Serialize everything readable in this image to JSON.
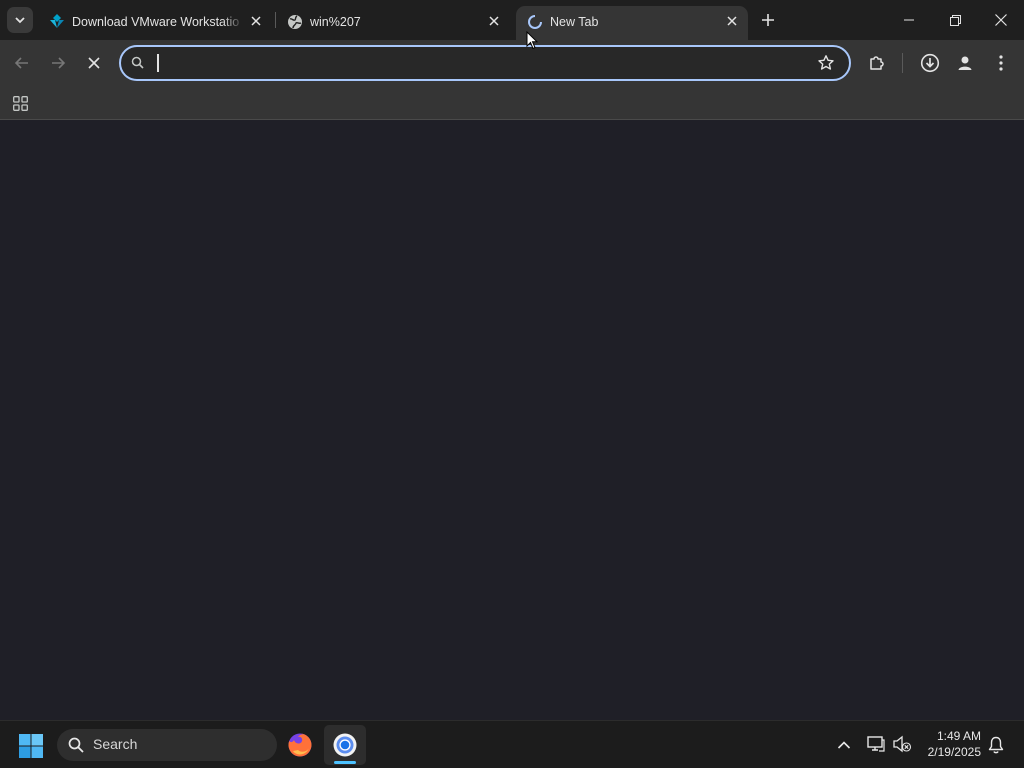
{
  "browser": {
    "tabs": [
      {
        "title": "Download VMware Workstation",
        "icon": "vmware-icon"
      },
      {
        "title": "win%207",
        "icon": "globe-icon"
      },
      {
        "title": "New Tab",
        "icon": "loading-spinner-icon",
        "active": true
      }
    ],
    "address_bar": {
      "value": "",
      "placeholder": ""
    },
    "colors": {
      "accent": "#a8c7fa",
      "toolbar": "#353535",
      "content_bg": "#1f1f27"
    }
  },
  "taskbar": {
    "search_label": "Search",
    "time": "1:49 AM",
    "date": "2/19/2025",
    "apps": [
      "firefox-icon",
      "chrome-icon"
    ]
  }
}
